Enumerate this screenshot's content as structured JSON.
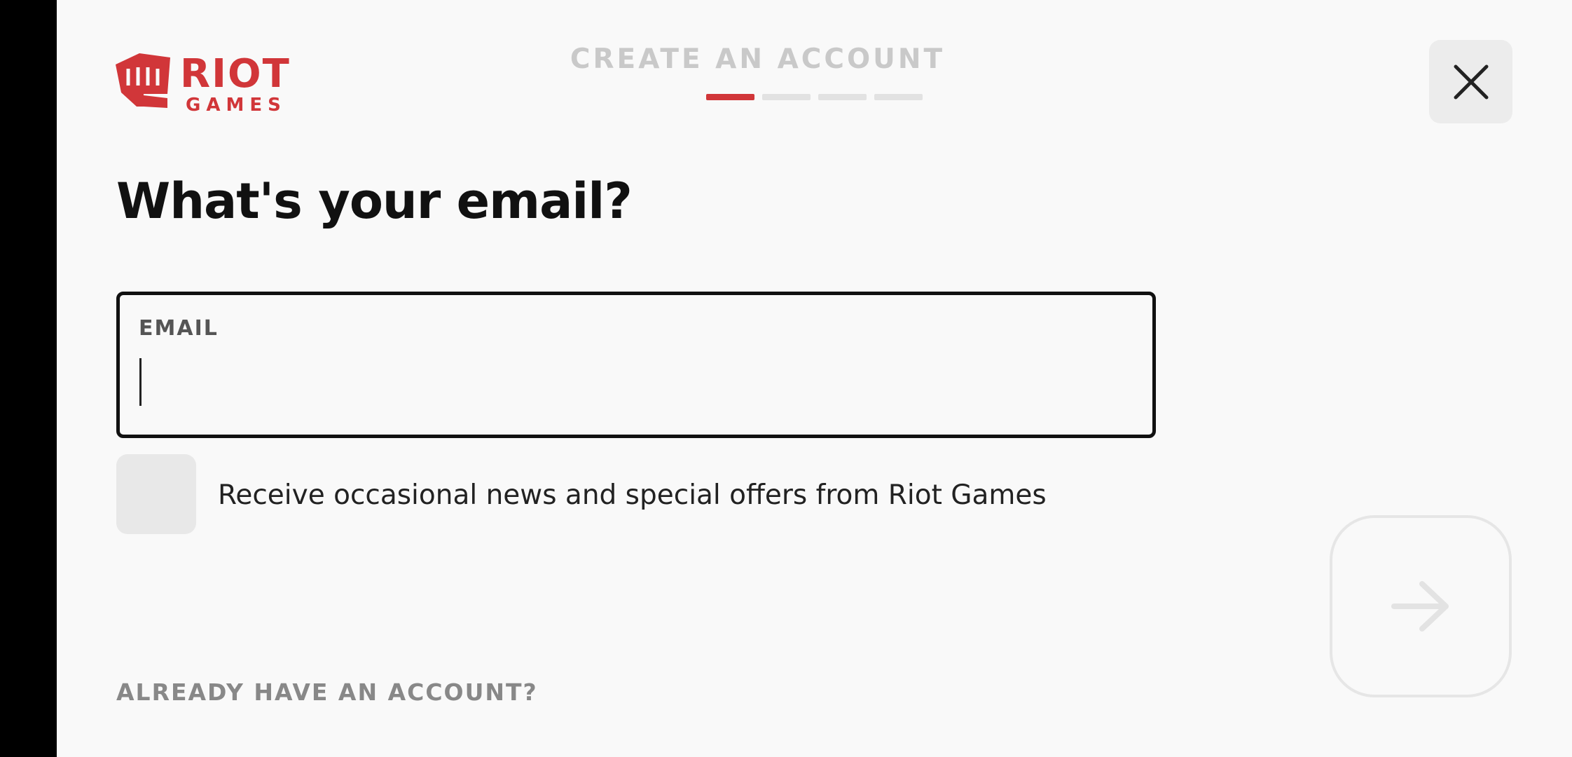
{
  "brand": {
    "logo_text_top": "RIOT",
    "logo_text_bottom": "GAMES",
    "accent_color": "#d13639"
  },
  "header": {
    "step_title": "CREATE AN ACCOUNT",
    "progress": {
      "current_step": 1,
      "total_steps": 4
    },
    "close_icon": "close-icon"
  },
  "main": {
    "heading": "What's your email?",
    "email": {
      "label": "EMAIL",
      "value": "",
      "placeholder": ""
    },
    "newsletter": {
      "checked": false,
      "label": "Receive occasional news and special offers from Riot Games"
    },
    "next_icon": "arrow-right-icon",
    "already_account_label": "ALREADY HAVE AN ACCOUNT?"
  }
}
